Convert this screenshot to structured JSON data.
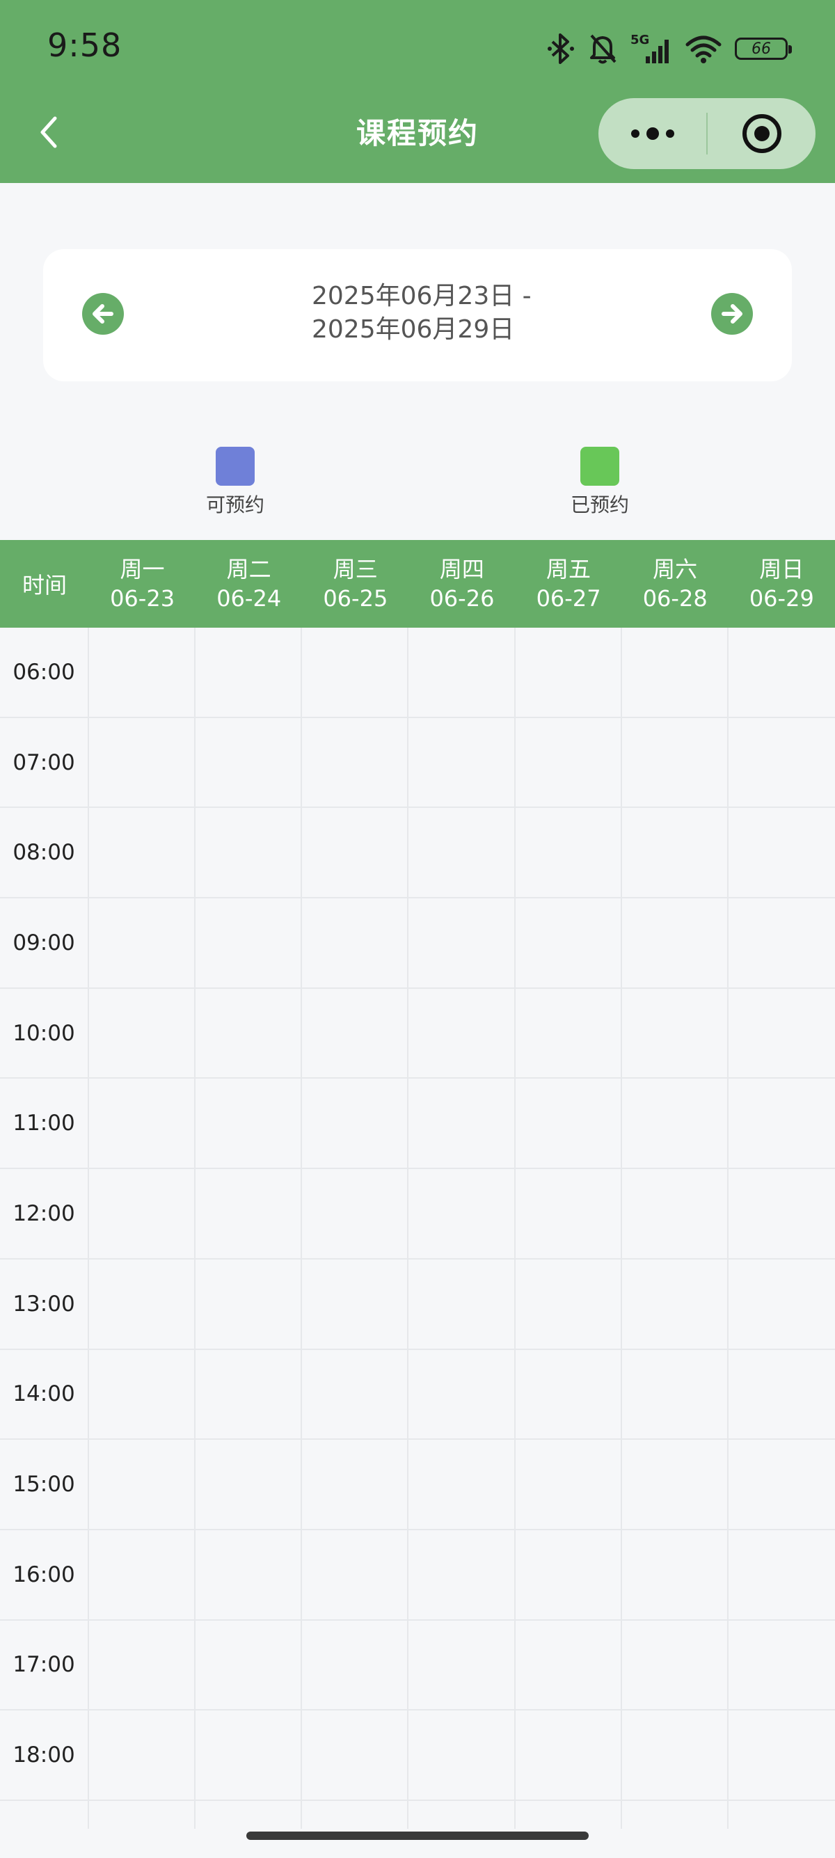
{
  "status_bar": {
    "time": "9:58",
    "battery": "66",
    "icons": [
      "bluetooth-icon",
      "mute-bell-icon",
      "5g-signal-icon",
      "wifi-icon",
      "battery-icon"
    ]
  },
  "nav": {
    "title": "课程预约",
    "back_icon": "chevron-left-icon",
    "more_icon": "more-dots-icon",
    "close_icon": "target-circle-icon"
  },
  "week": {
    "range_start": "2025年06月23日 -",
    "range_end": "2025年06月29日"
  },
  "legend": [
    {
      "label": "可预约",
      "color": "#6f80d8"
    },
    {
      "label": "已预约",
      "color": "#68c758"
    }
  ],
  "schedule": {
    "time_header": "时间",
    "days": [
      {
        "name": "周一",
        "date": "06-23"
      },
      {
        "name": "周二",
        "date": "06-24"
      },
      {
        "name": "周三",
        "date": "06-25"
      },
      {
        "name": "周四",
        "date": "06-26"
      },
      {
        "name": "周五",
        "date": "06-27"
      },
      {
        "name": "周六",
        "date": "06-28"
      },
      {
        "name": "周日",
        "date": "06-29"
      }
    ],
    "times": [
      "06:00",
      "07:00",
      "08:00",
      "09:00",
      "10:00",
      "11:00",
      "12:00",
      "13:00",
      "14:00",
      "15:00",
      "16:00",
      "17:00",
      "18:00"
    ]
  },
  "colors": {
    "brand_green": "#66ad68",
    "available": "#6f80d8",
    "booked": "#68c758"
  }
}
